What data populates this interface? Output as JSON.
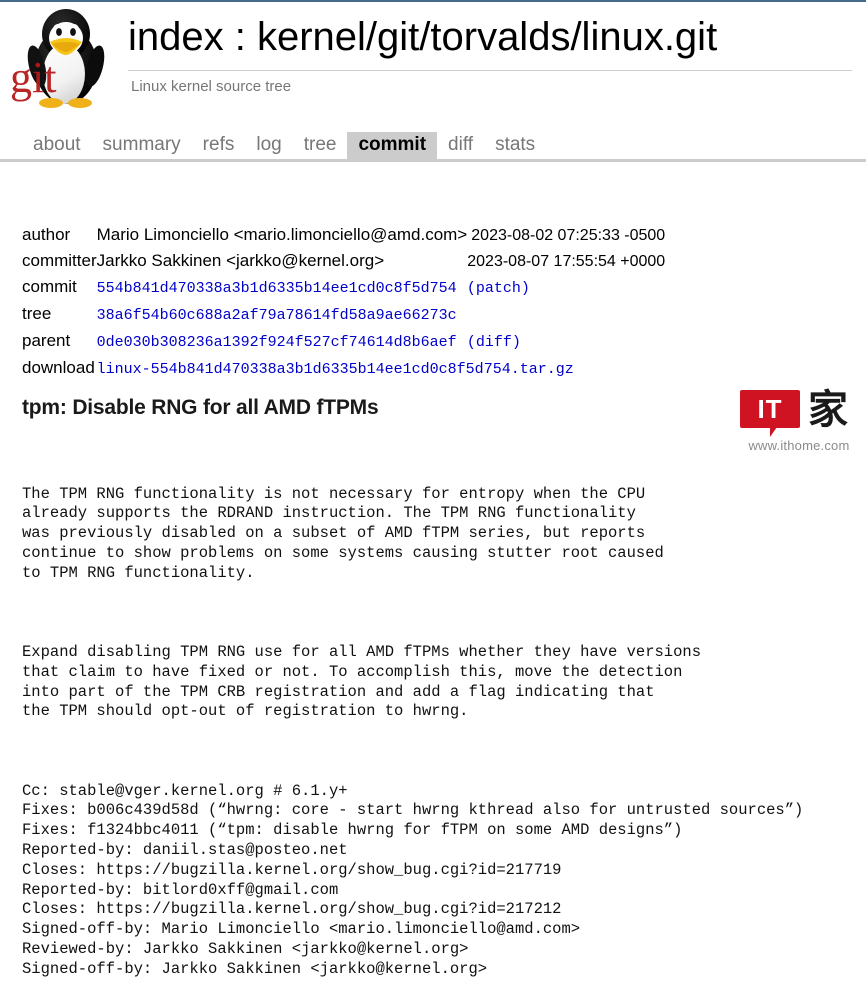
{
  "top_rule_color": "#46698a",
  "link_color": "#0000cc",
  "active_tab_bg": "#cccccc",
  "header": {
    "logo_alt": "cgit-linux-penguin-logo",
    "logo_text": "git",
    "title": "index : kernel/git/torvalds/linux.git",
    "subtitle": "Linux kernel source tree"
  },
  "tabs": [
    {
      "label": "about",
      "active": false
    },
    {
      "label": "summary",
      "active": false
    },
    {
      "label": "refs",
      "active": false
    },
    {
      "label": "log",
      "active": false
    },
    {
      "label": "tree",
      "active": false
    },
    {
      "label": "commit",
      "active": true
    },
    {
      "label": "diff",
      "active": false
    },
    {
      "label": "stats",
      "active": false
    }
  ],
  "commit_info": {
    "labels": {
      "author": "author",
      "committer": "committer",
      "commit": "commit",
      "tree": "tree",
      "parent": "parent",
      "download": "download"
    },
    "author": {
      "name_email": "Mario Limonciello <mario.limonciello@amd.com>",
      "date": "2023-08-02 07:25:33 -0500"
    },
    "committer": {
      "name_email": "Jarkko Sakkinen <jarkko@kernel.org>",
      "date": "2023-08-07 17:55:54 +0000"
    },
    "commit": {
      "hash": "554b841d470338a3b1d6335b14ee1cd0c8f5d754",
      "extra": "(patch)"
    },
    "tree": {
      "hash": "38a6f54b60c688a2af79a78614fd58a9ae66273c",
      "extra": ""
    },
    "parent": {
      "hash": "0de030b308236a1392f924f527cf74614d8b6aef",
      "extra": "(diff)"
    },
    "download": {
      "filename": "linux-554b841d470338a3b1d6335b14ee1cd0c8f5d754.tar.gz"
    }
  },
  "commit": {
    "subject": "tpm: Disable RNG for all AMD fTPMs",
    "message_paragraphs": [
      "The TPM RNG functionality is not necessary for entropy when the CPU\nalready supports the RDRAND instruction. The TPM RNG functionality\nwas previously disabled on a subset of AMD fTPM series, but reports\ncontinue to show problems on some systems causing stutter root caused\nto TPM RNG functionality.",
      "Expand disabling TPM RNG use for all AMD fTPMs whether they have versions\nthat claim to have fixed or not. To accomplish this, move the detection\ninto part of the TPM CRB registration and add a flag indicating that\nthe TPM should opt-out of registration to hwrng.",
      "Cc: stable@vger.kernel.org # 6.1.y+\nFixes: b006c439d58d (“hwrng: core - start hwrng kthread also for untrusted sources”)\nFixes: f1324bbc4011 (“tpm: disable hwrng for fTPM on some AMD designs”)\nReported-by: daniil.stas@posteo.net\nCloses: https://bugzilla.kernel.org/show_bug.cgi?id=217719\nReported-by: bitlord0xff@gmail.com\nCloses: https://bugzilla.kernel.org/show_bug.cgi?id=217212\nSigned-off-by: Mario Limonciello <mario.limonciello@amd.com>\nReviewed-by: Jarkko Sakkinen <jarkko@kernel.org>\nSigned-off-by: Jarkko Sakkinen <jarkko@kernel.org>"
    ]
  },
  "watermark": {
    "badge_text": "IT",
    "cjk_text": "家",
    "url": "www.ithome.com",
    "badge_color": "#cf1322"
  }
}
